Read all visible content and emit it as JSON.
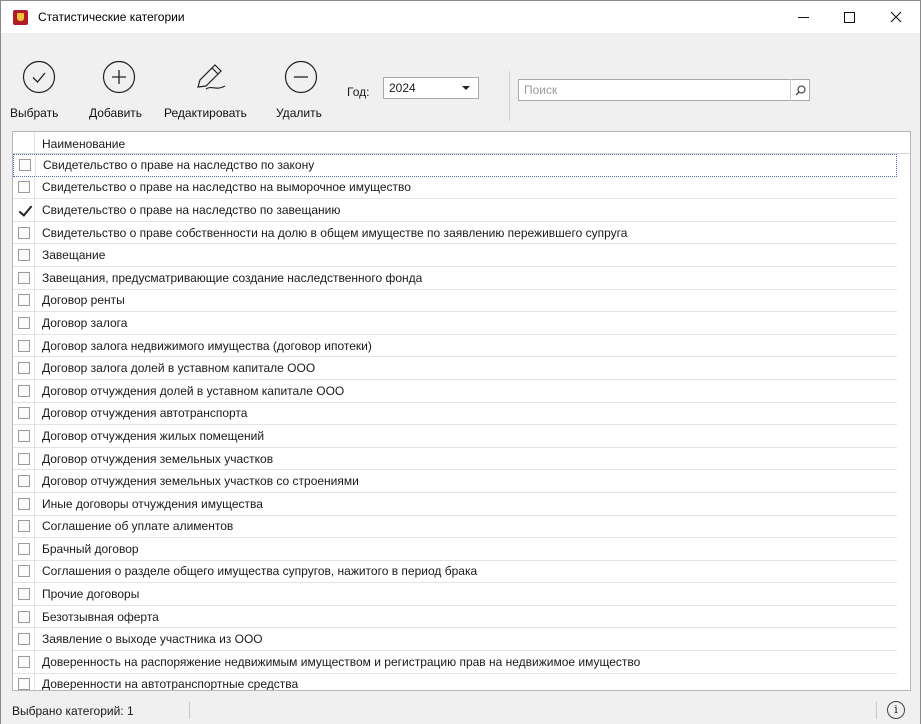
{
  "window": {
    "title": "Статистические категории"
  },
  "toolbar": {
    "select_label": "Выбрать",
    "add_label": "Добавить",
    "edit_label": "Редактировать",
    "delete_label": "Удалить",
    "year_label": "Год:",
    "year_value": "2024",
    "search_placeholder": "Поиск"
  },
  "grid": {
    "column_name": "Наименование",
    "rows": [
      {
        "label": "Свидетельство о праве на наследство по закону",
        "checked": false,
        "selected": true
      },
      {
        "label": "Свидетельство о праве на наследство на выморочное имущество",
        "checked": false
      },
      {
        "label": "Свидетельство о праве на наследство по завещанию",
        "checked": true
      },
      {
        "label": "Свидетельство о праве собственности на долю в общем имуществе по заявлению пережившего супруга",
        "checked": false
      },
      {
        "label": "Завещание",
        "checked": false
      },
      {
        "label": "Завещания, предусматривающие создание наследственного фонда",
        "checked": false
      },
      {
        "label": "Договор ренты",
        "checked": false
      },
      {
        "label": "Договор залога",
        "checked": false
      },
      {
        "label": "Договор залога недвижимого имущества (договор ипотеки)",
        "checked": false
      },
      {
        "label": "Договор залога долей в уставном капитале ООО",
        "checked": false
      },
      {
        "label": "Договор отчуждения долей в уставном капитале ООО",
        "checked": false
      },
      {
        "label": "Договор отчуждения автотранспорта",
        "checked": false
      },
      {
        "label": "Договор отчуждения жилых помещений",
        "checked": false
      },
      {
        "label": "Договор отчуждения земельных участков",
        "checked": false
      },
      {
        "label": "Договор отчуждения земельных участков со строениями",
        "checked": false
      },
      {
        "label": "Иные договоры отчуждения имущества",
        "checked": false
      },
      {
        "label": "Соглашение об уплате алиментов",
        "checked": false
      },
      {
        "label": "Брачный договор",
        "checked": false
      },
      {
        "label": "Соглашения о разделе общего имущества супругов, нажитого в период брака",
        "checked": false
      },
      {
        "label": "Прочие договоры",
        "checked": false
      },
      {
        "label": "Безотзывная оферта",
        "checked": false
      },
      {
        "label": "Заявление о выходе участника из ООО",
        "checked": false
      },
      {
        "label": "Доверенность на распоряжение недвижимым имуществом и регистрацию прав на недвижимое имущество",
        "checked": false
      },
      {
        "label": "Доверенности на автотранспортные средства",
        "checked": false
      }
    ]
  },
  "status": {
    "selected_text": "Выбрано категорий: 1",
    "info_glyph": "i"
  }
}
